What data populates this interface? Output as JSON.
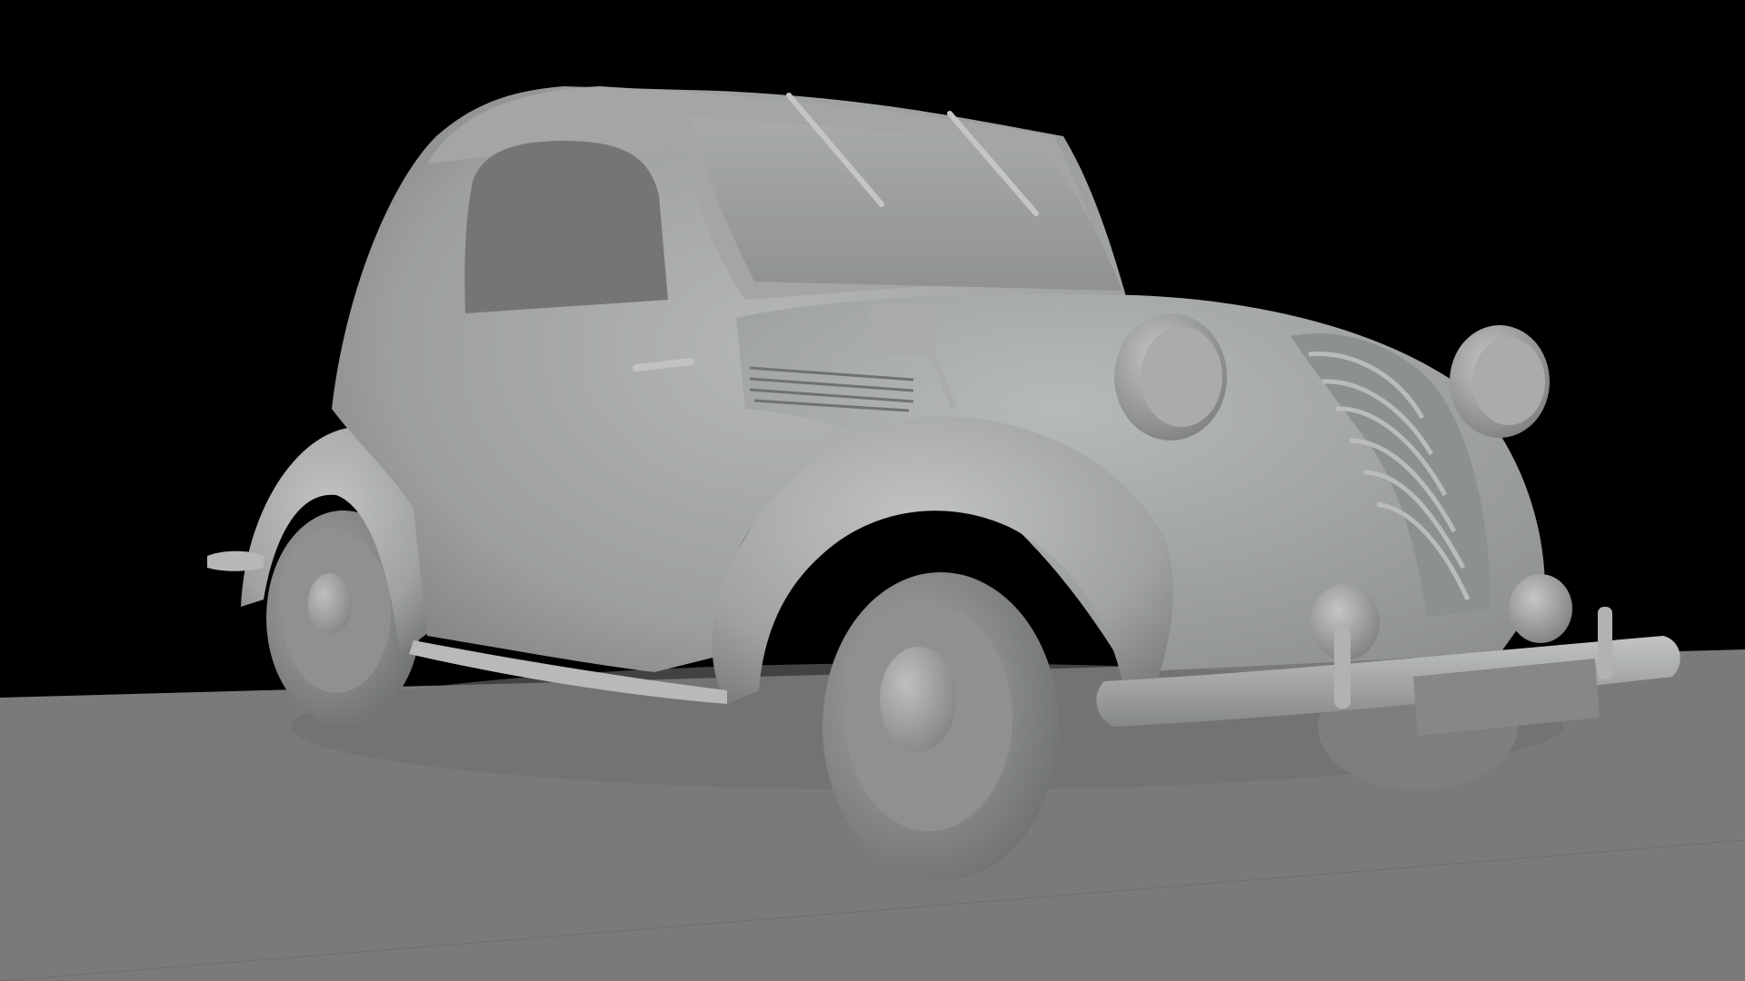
{
  "scene": {
    "background_color": "#000000",
    "ground_color": "#7a7a7a",
    "model_color": "#9a9d9c",
    "window_color": "#777474"
  },
  "model": {
    "subject": "car",
    "render_style": "untextured grey clay"
  }
}
